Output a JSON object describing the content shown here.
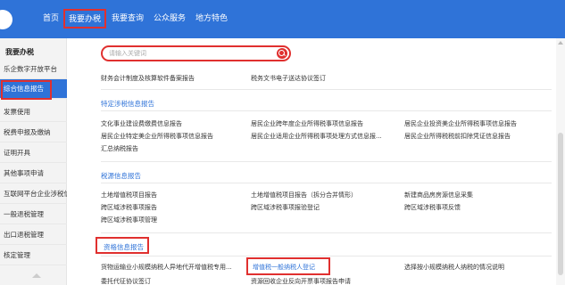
{
  "nav": {
    "items": [
      "首页",
      "我要办税",
      "我要查询",
      "公众服务",
      "地方特色"
    ]
  },
  "sidebar": {
    "title": "我要办税",
    "items": [
      "乐企数字开放平台",
      "综合信息报告",
      "发票使用",
      "税费申报及缴纳",
      "证明开具",
      "其他事项申请",
      "互联网平台企业涉税信息报送",
      "一般退税管理",
      "出口退税管理",
      "核定管理"
    ]
  },
  "search": {
    "placeholder": "请输入关键词"
  },
  "sections": {
    "top_row": [
      "财务会计制度及核算软件备案报告",
      "税务文书电子送达协议签订"
    ],
    "special": {
      "title": "特定涉税信息报告",
      "row1": [
        "文化事业建设费缴费信息报告",
        "居民企业跨年度企业所得税事项信息报告",
        "居民企业投资美企业所得税事项信息报告"
      ],
      "row2": [
        "居民企业特定美企业所得税事项信息报告",
        "居民企业适用企业所得税事项处理方式信息报...",
        "居民企业所得税税前扣除凭证信息报告"
      ],
      "row3": [
        "汇总纳税报告"
      ]
    },
    "source": {
      "title": "税源信息报告",
      "row1": [
        "土地增值税项目报告",
        "土地增值税项目报告（拆分合并情形）",
        "新建商品房房源信息采集"
      ],
      "row2": [
        "跨区域涉税事项报告",
        "跨区域涉税事项报验登记",
        "跨区域涉税事项反馈"
      ],
      "row3": [
        "跨区域涉税事项管理"
      ]
    },
    "qualification": {
      "title": "资格信息报告",
      "row1": [
        "货物运输业小规模纳税人异地代开增值税专用...",
        "增值税一般纳税人登记",
        "选择按小规模纳税人纳税的情况说明"
      ],
      "row2": [
        "委托代征协议签订",
        "资源回收企业反向开票事项报告申请"
      ]
    }
  },
  "colors": {
    "nav_blue": "#2f73d8",
    "highlight_red": "#e0302f"
  }
}
